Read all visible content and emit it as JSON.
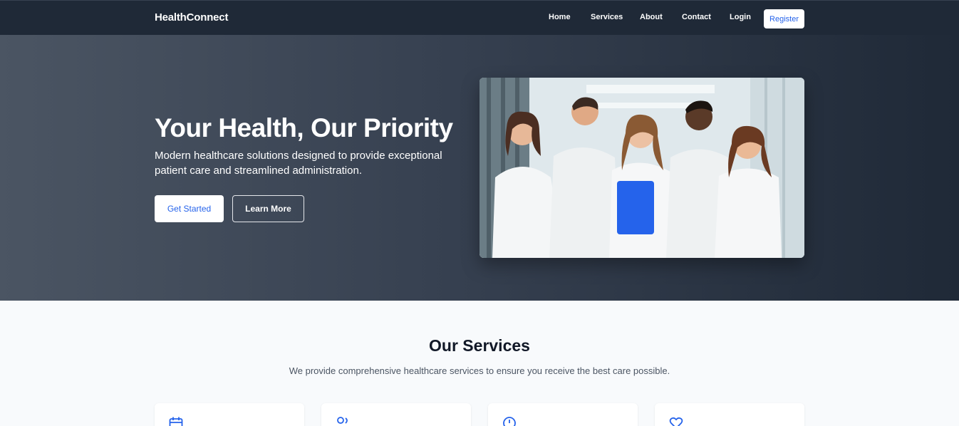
{
  "nav": {
    "brand": "HealthConnect",
    "links": [
      "Home",
      "Services",
      "About",
      "Contact",
      "Login"
    ],
    "register_label": "Register"
  },
  "hero": {
    "title": "Your Health, Our Priority",
    "subtitle": "Modern healthcare solutions designed to provide exceptional patient care and streamlined administration.",
    "primary_button": "Get Started",
    "secondary_button": "Learn More"
  },
  "services": {
    "title": "Our Services",
    "subtitle": "We provide comprehensive healthcare services to ensure you receive the best care possible.",
    "cards": [
      {
        "icon": "calendar-icon"
      },
      {
        "icon": "users-icon"
      },
      {
        "icon": "clock-icon"
      },
      {
        "icon": "heart-icon"
      }
    ]
  },
  "colors": {
    "nav_bg": "#1f2937",
    "hero_bg_start": "#4b5563",
    "hero_bg_end": "#1f2937",
    "accent": "#2563eb"
  }
}
